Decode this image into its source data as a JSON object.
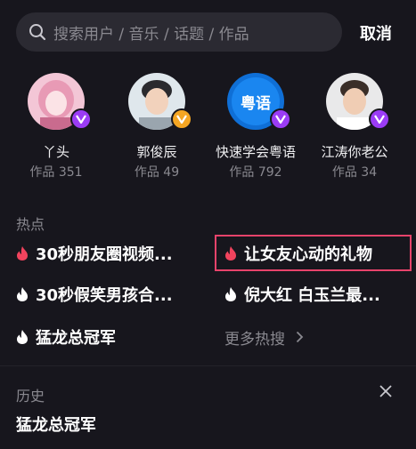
{
  "search": {
    "placeholder": "搜索用户 / 音乐 / 话题 / 作品",
    "cancel_label": "取消"
  },
  "users": [
    {
      "name": "丫头",
      "works": "作品 351",
      "badge": "purple"
    },
    {
      "name": "郭俊辰",
      "works": "作品 49",
      "badge": "orange"
    },
    {
      "name": "快速学会粤语",
      "works": "作品 792",
      "badge": "purple",
      "avatar_text": "粤语"
    },
    {
      "name": "江涛你老公",
      "works": "作品 34",
      "badge": "purple"
    }
  ],
  "hot": {
    "title": "热点",
    "items": [
      {
        "label": "30秒朋友圈视频...",
        "flame": "red"
      },
      {
        "label": "让女友心动的礼物",
        "flame": "red",
        "highlighted": true
      },
      {
        "label": "30秒假笑男孩合...",
        "flame": "white"
      },
      {
        "label": "倪大红 白玉兰最...",
        "flame": "white"
      },
      {
        "label": "猛龙总冠军",
        "flame": "white"
      }
    ],
    "more_label": "更多热搜"
  },
  "history": {
    "title": "历史",
    "items": [
      "猛龙总冠军"
    ]
  },
  "colors": {
    "background": "#17161d",
    "search_bg": "#2b2a32",
    "muted_text": "#8a8990",
    "flame_red": "#f1435d",
    "badge_purple": "#9b3cf5",
    "badge_orange": "#f5a623",
    "highlight_border": "#e8436b"
  }
}
